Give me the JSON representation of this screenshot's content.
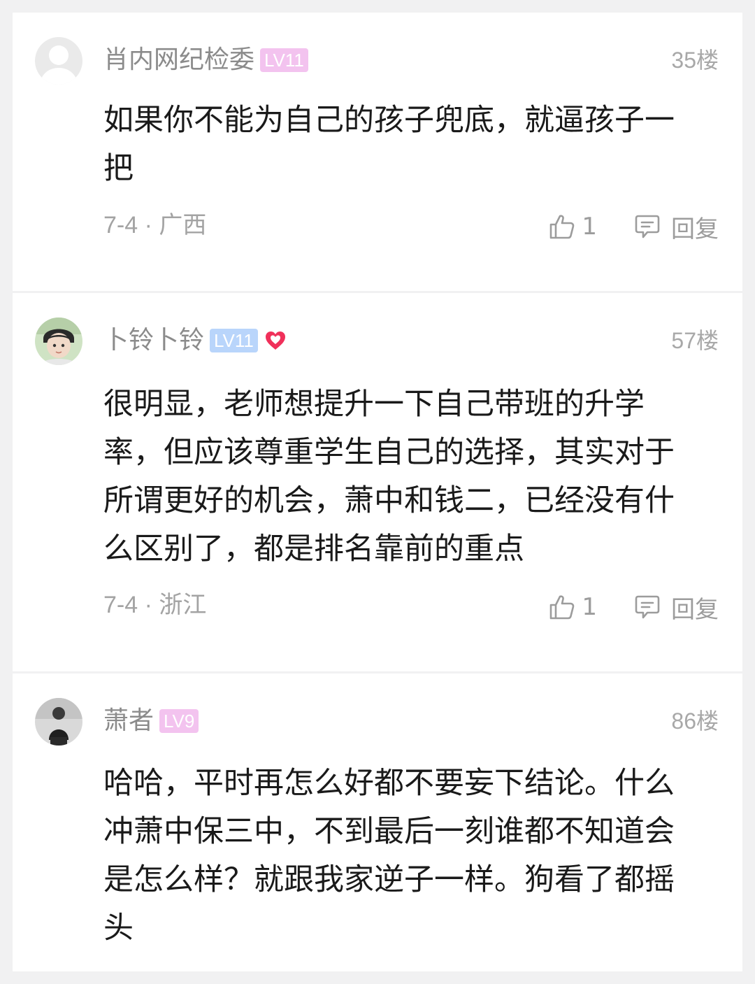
{
  "comments": [
    {
      "username": "肖内网纪检委",
      "level": "LV11",
      "level_color": "#f3c3ef",
      "floor": "35楼",
      "avatar": "default-avatar",
      "text": "如果你不能为自己的孩子兜底，就逼孩子一把",
      "meta": "7-4 · 广西",
      "likes": "1",
      "reply_label": "回复"
    },
    {
      "username": "卜铃卜铃",
      "level": "LV11",
      "level_color": "#b9d5fb",
      "badge_icon": "heart-icon",
      "badge_color": "#f0305a",
      "floor": "57楼",
      "avatar": "user-photo-avatar",
      "text": "很明显，老师想提升一下自己带班的升学率，但应该尊重学生自己的选择，其实对于所谓更好的机会，萧中和钱二，已经没有什么区别了，都是排名靠前的重点",
      "meta": "7-4 · 浙江",
      "likes": "1",
      "reply_label": "回复"
    },
    {
      "username": "萧者",
      "level": "LV9",
      "level_color": "#f3c3ef",
      "floor": "86楼",
      "avatar": "user-photo-avatar",
      "text": "哈哈，平时再怎么好都不要妄下结论。什么冲萧中保三中，不到最后一刻谁都不知道会是怎么样？就跟我家逆子一样。狗看了都摇头"
    }
  ]
}
